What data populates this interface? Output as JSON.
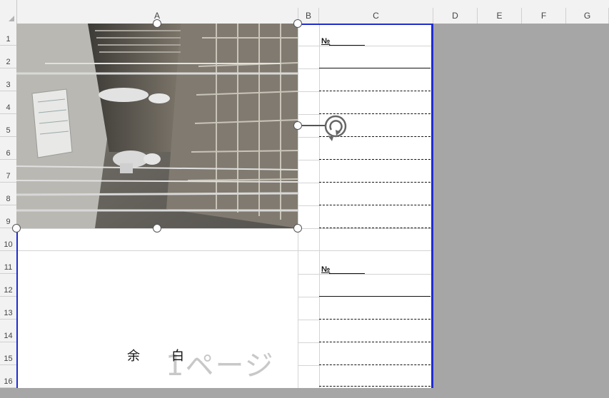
{
  "columns": [
    "A",
    "B",
    "C",
    "D",
    "E",
    "F",
    "G"
  ],
  "rows": [
    "1",
    "2",
    "3",
    "4",
    "5",
    "6",
    "7",
    "8",
    "9",
    "10",
    "11",
    "12",
    "13",
    "14",
    "15",
    "16"
  ],
  "form_blocks": [
    {
      "no_label": "№"
    },
    {
      "no_label": "№"
    }
  ],
  "margin_text": {
    "char1": "余",
    "char2": "白"
  },
  "page_watermark": "1ページ",
  "image": {
    "description_icon": "inserted-photo"
  },
  "colors": {
    "print_area_border": "#1f2bd0",
    "outside_area": "#a6a6a6",
    "header_bg": "#f2f2f2"
  }
}
